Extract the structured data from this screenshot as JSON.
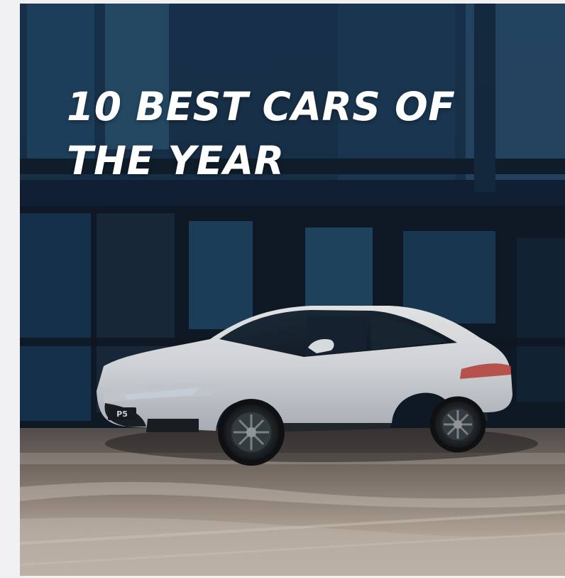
{
  "hero": {
    "headline_line1": "10 BEST CARS OF",
    "headline_line2": "THE YEAR",
    "plate_text": "P5",
    "image_description_icon": "car-photo-icon"
  },
  "colors": {
    "building_dark": "#17283a",
    "window_blue": "#23496a",
    "car_white": "#f3f4f6",
    "road_beige": "#b9a89a",
    "text_white": "#ffffff"
  }
}
